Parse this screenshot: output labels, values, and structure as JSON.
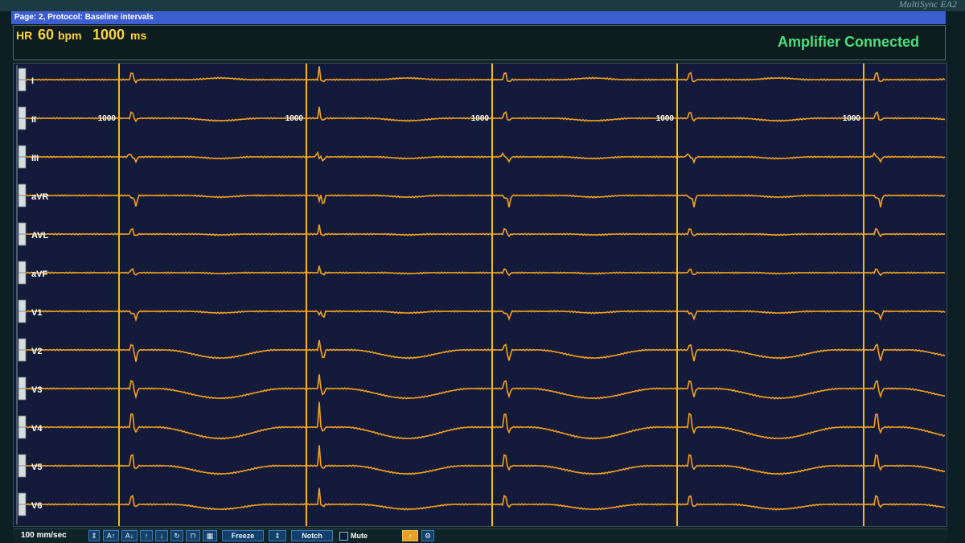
{
  "title_bar": {
    "text": "Page: 2, Protocol: Baseline intervals"
  },
  "monitor_brand": "MultiSync EA2",
  "header": {
    "hr_label": "HR",
    "hr_value": "60",
    "hr_unit": "bpm",
    "cycle_value": "1000",
    "cycle_unit": "ms",
    "amplifier_status": "Amplifier Connected"
  },
  "leads": [
    "I",
    "II",
    "III",
    "aVR",
    "AVL",
    "aVF",
    "V1",
    "V2",
    "V3",
    "V4",
    "V5",
    "V6"
  ],
  "rr_interval_label": "1000",
  "beat_count": 5,
  "toolbar": {
    "sweep_speed": "100 mm/sec",
    "gain_up_label": "A↑",
    "gain_down_label": "A↓",
    "freeze_label": "Freeze",
    "notch_label": "Notch",
    "mute_label": "Mute"
  },
  "colors": {
    "trace": "#f6a21b",
    "caliper": "#f4b817",
    "background": "#141b3a",
    "status_ok": "#4be07a",
    "header_text": "#ffd43a",
    "title_bar": "#3d5ed0"
  }
}
